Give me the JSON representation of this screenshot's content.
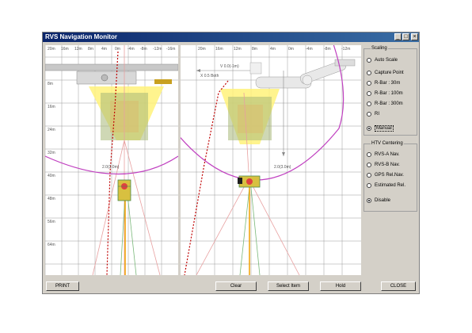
{
  "window": {
    "title": "RVS Navigation Monitor"
  },
  "titlebar_buttons": [
    "_",
    "□",
    "×"
  ],
  "left_plot": {
    "top_ticks": [
      "20m",
      "16m",
      "12m",
      "8m",
      "4m",
      "0m",
      "-4m",
      "-8m",
      "-12m",
      "-16m"
    ],
    "left_ticks": [
      "0m",
      "8m",
      "16m",
      "24m",
      "32m",
      "40m",
      "48m",
      "56m",
      "64m"
    ],
    "annotation": "2.0(3.0m)"
  },
  "right_plot": {
    "top_ticks": [
      "20m",
      "16m",
      "12m",
      "8m",
      "4m",
      "0m",
      "-4m",
      "-8m",
      "-12m"
    ],
    "annotations": [
      "V 0.0(-1m)",
      "X 0.5 Both",
      "2.0(3.0m)"
    ]
  },
  "scaling": {
    "label": "Scaling",
    "options": [
      {
        "label": "Auto Scale",
        "selected": false
      },
      {
        "label": "Capture Point",
        "selected": false
      },
      {
        "label": "R-Bar : 30m",
        "selected": false
      },
      {
        "label": "R-Bar : 100m",
        "selected": false
      },
      {
        "label": "R-Bar : 300m",
        "selected": false
      },
      {
        "label": "RI",
        "selected": false
      },
      {
        "label": "Manual",
        "selected": true
      }
    ]
  },
  "htv_centering": {
    "label": "HTV Centering",
    "options": [
      {
        "label": "RVS-A Nav.",
        "selected": false
      },
      {
        "label": "RVS-B Nav.",
        "selected": false
      },
      {
        "label": "GPS Rel.Nav.",
        "selected": false
      },
      {
        "label": "Estimated Rel.",
        "selected": false
      },
      {
        "label": "Disable",
        "selected": true
      }
    ]
  },
  "buttons": {
    "print": "PRINT",
    "clear": "Clear",
    "select_item": "Select Item",
    "hold": "Hold",
    "close": "CLOSE"
  },
  "colors": {
    "title_bg": "#0a246a",
    "grid": "#9a9a9a",
    "fov_yellow": "#fff27a",
    "target_green": "#7ab87a",
    "circle_magenta": "#c040c0",
    "trajectory_red": "#c00000"
  }
}
